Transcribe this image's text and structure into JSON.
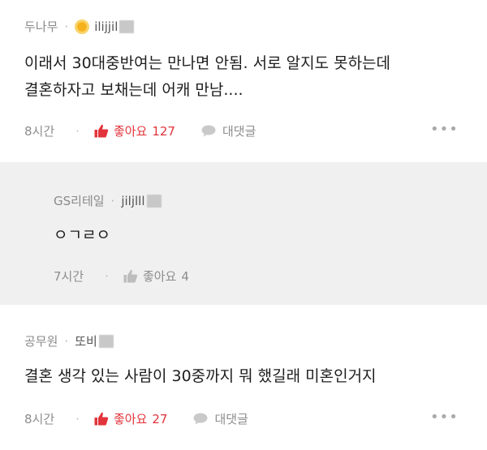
{
  "comments": [
    {
      "nickname": "두나무",
      "separator": "·",
      "username": "ilijjil",
      "text_lines": [
        "이래서 30대중반여는 만나면 안됨. 서로 알지도 못하는데",
        "결혼하자고 보채는데 어캐 만남...."
      ],
      "time": "8시간",
      "like_label": "좋아요",
      "like_count": "127",
      "reply_label": "대댓글",
      "more": "•••"
    },
    {
      "nickname": "GS리테일",
      "separator": "·",
      "username": "jiljlll",
      "text_lines": [
        "ㅇㄱㄹㅇ"
      ],
      "time": "7시간",
      "like_label": "좋아요",
      "like_count": "4"
    },
    {
      "nickname": "공무원",
      "separator": "·",
      "username": "또비",
      "text_lines": [
        "결혼 생각 있는 사람이 30중까지 뭐 했길래 미혼인거지"
      ],
      "time": "8시간",
      "like_label": "좋아요",
      "like_count": "27",
      "reply_label": "대댓글",
      "more": "•••"
    }
  ],
  "colors": {
    "like_active": "#e2343b",
    "reply_bg": "#f0f0f0",
    "muted": "#8d8d8d"
  },
  "icons": [
    "badge-icon",
    "thumbs-up-icon",
    "speech-bubble-icon",
    "more-icon"
  ]
}
